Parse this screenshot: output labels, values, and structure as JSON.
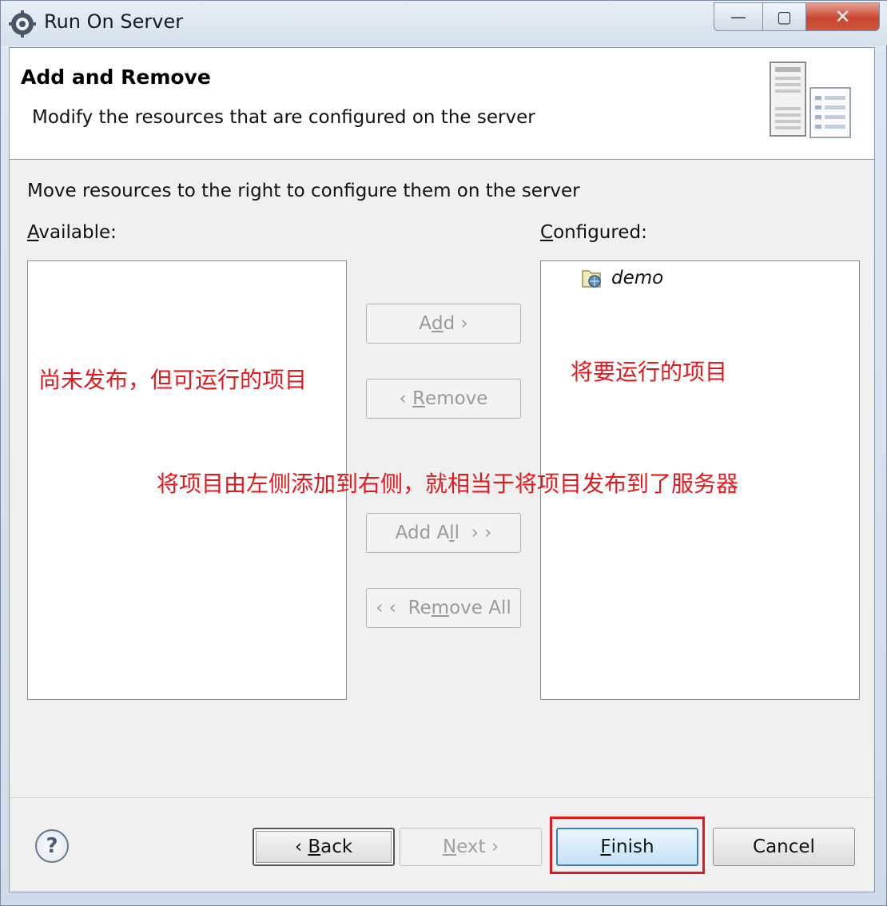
{
  "window": {
    "title": "Run On Server",
    "controls": {
      "minimize": "—",
      "maximize": "▢",
      "close": "✕"
    }
  },
  "header": {
    "title": "Add and Remove",
    "description": "Modify the resources that are configured on the server",
    "graphic_icon": "server-wizard-icon"
  },
  "main": {
    "instruction": "Move resources to the right to configure them on the server",
    "available_label_mnemonic": "A",
    "available_label_rest": "vailable:",
    "configured_label_mnemonic": "C",
    "configured_label_rest": "onfigured:",
    "available_items": [],
    "configured_items": [
      {
        "label": "demo",
        "icon": "web-project-icon"
      }
    ]
  },
  "side_buttons": {
    "add_pre": "A",
    "add_mn": "d",
    "add_post": "d ›",
    "remove_pre": "‹ ",
    "remove_mn": "R",
    "remove_post": "emove",
    "add_all_pre": "Add A",
    "add_all_mn": "l",
    "add_all_post": "l  › ›",
    "remove_all_pre": "‹ ‹  Re",
    "remove_all_mn": "m",
    "remove_all_post": "ove All"
  },
  "annotations": {
    "available_note": "尚未发布，但可运行的项目",
    "configured_note": "将要运行的项目",
    "center_note": "将项目由左侧添加到右侧，就相当于将项目发布到了服务器"
  },
  "footer": {
    "help": "?",
    "back_pre": "‹ ",
    "back_mn": "B",
    "back_post": "ack",
    "next_mn": "N",
    "next_post": "ext ›",
    "finish_mn": "F",
    "finish_post": "inish",
    "cancel": "Cancel"
  },
  "colors": {
    "annotation": "#e5191c",
    "disabled_text": "#9a9a9a",
    "finish_border": "#3c7fb1"
  }
}
